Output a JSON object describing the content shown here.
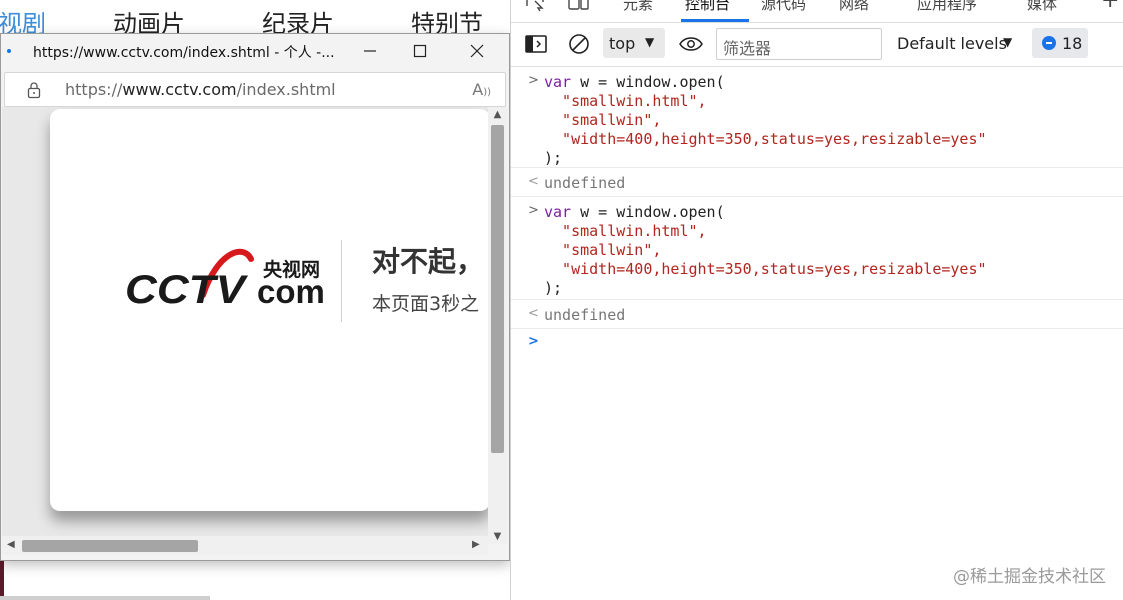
{
  "background_page": {
    "nav_items": [
      "视剧",
      "动画片",
      "纪录片",
      "特别节"
    ]
  },
  "popup": {
    "title": "https://www.cctv.com/index.shtml - 个人 -...",
    "address": {
      "scheme": "https://",
      "host": "www.cctv.com",
      "path": "/index.shtml"
    },
    "content": {
      "logo_text_cn": "央视网",
      "logo_text_main": "CCTV",
      "logo_text_com": "com",
      "heading": "对不起，",
      "message": "本页面3秒之"
    }
  },
  "devtools": {
    "tabs": [
      "元素",
      "控制台",
      "源代码",
      "网络",
      "应用程序",
      "媒体"
    ],
    "active_tab": "控制台",
    "toolbar": {
      "context": "top",
      "filter_placeholder": "筛选器",
      "levels": "Default levels",
      "issues_count": "18"
    },
    "console_entries": [
      {
        "lines": [
          "var w = window.open(",
          "  \"smallwin.html\",",
          "  \"smallwin\",",
          "  \"width=400,height=350,status=yes,resizable=yes\"",
          ");"
        ],
        "result": "undefined"
      },
      {
        "lines": [
          "var w = window.open(",
          "  \"smallwin.html\",",
          "  \"smallwin\",",
          "  \"width=400,height=350,status=yes,resizable=yes\"",
          ");"
        ],
        "result": "undefined"
      }
    ]
  },
  "watermark": "@稀土掘金技术社区",
  "colors": {
    "accent": "#1a73e8",
    "keyword": "#7a1fa2",
    "string": "#b0261e",
    "cctv_red": "#d7191e"
  }
}
